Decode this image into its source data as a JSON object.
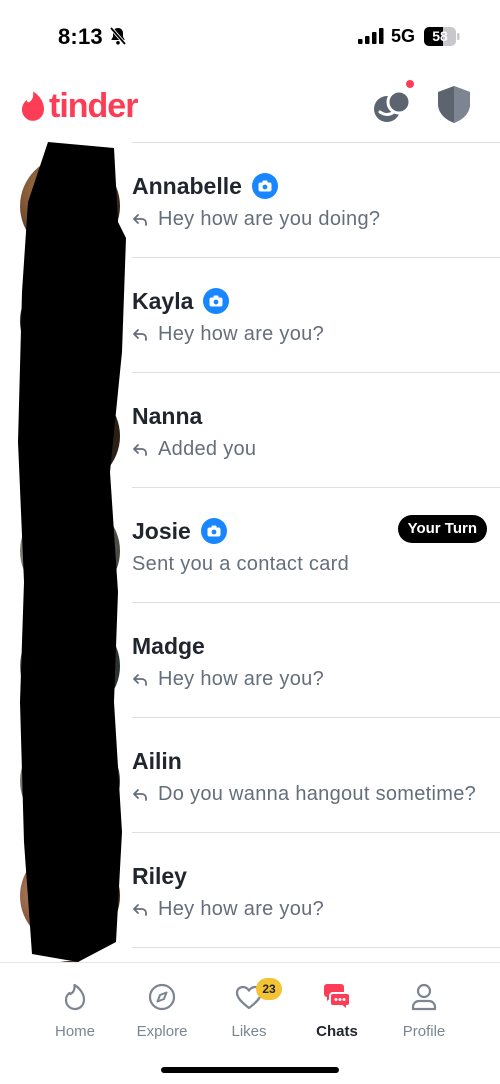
{
  "status_bar": {
    "time": "8:13",
    "network": "5G",
    "battery": "58"
  },
  "header": {
    "logo_text": "tinder",
    "brand_color": "#fd3c55",
    "icons": [
      "match-group-icon",
      "shield-icon"
    ]
  },
  "chats": [
    {
      "name": "Annabelle",
      "verified_photo": true,
      "replied": true,
      "preview": "Hey how are you doing?",
      "your_turn": false
    },
    {
      "name": "Kayla",
      "verified_photo": true,
      "replied": true,
      "preview": "Hey how are you?",
      "your_turn": false
    },
    {
      "name": "Nanna",
      "verified_photo": false,
      "replied": true,
      "preview": "Added you",
      "your_turn": false
    },
    {
      "name": "Josie",
      "verified_photo": true,
      "replied": false,
      "preview": "Sent you a contact card",
      "your_turn": true,
      "your_turn_label": "Your Turn"
    },
    {
      "name": "Madge",
      "verified_photo": false,
      "replied": true,
      "preview": "Hey how are you?",
      "your_turn": false
    },
    {
      "name": "Ailin",
      "verified_photo": false,
      "replied": true,
      "preview": "Do you wanna hangout sometime?",
      "your_turn": false
    },
    {
      "name": "Riley",
      "verified_photo": false,
      "replied": true,
      "preview": "Hey how are you?",
      "your_turn": false
    }
  ],
  "tabs": [
    {
      "label": "Home",
      "icon": "flame-icon",
      "active": false
    },
    {
      "label": "Explore",
      "icon": "compass-icon",
      "active": false
    },
    {
      "label": "Likes",
      "icon": "heart-icon",
      "active": false,
      "badge": "23"
    },
    {
      "label": "Chats",
      "icon": "chat-bubbles-icon",
      "active": true
    },
    {
      "label": "Profile",
      "icon": "person-icon",
      "active": false
    }
  ]
}
